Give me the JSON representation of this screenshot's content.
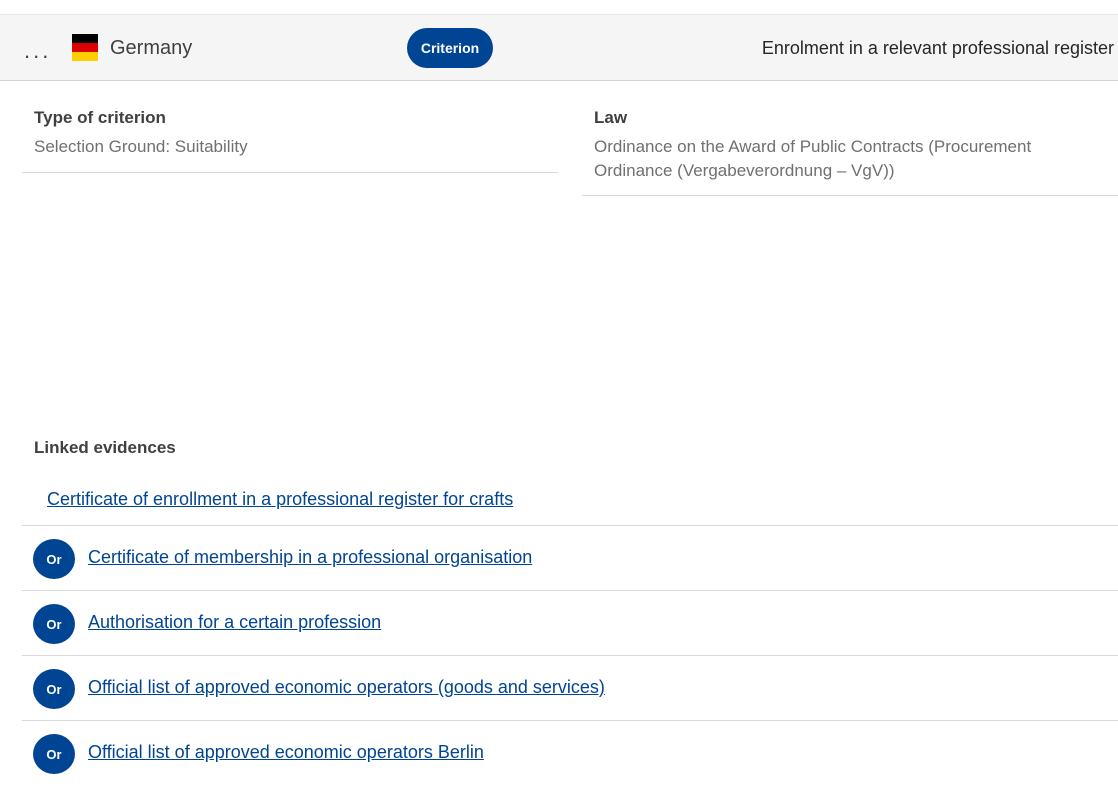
{
  "header": {
    "more_label": "...",
    "country": "Germany",
    "flag_icon": "germany-flag-icon",
    "flag_colors": [
      "#000000",
      "#dd0000",
      "#ffce00"
    ],
    "badge": "Criterion",
    "title": "Enrolment in a relevant professional register"
  },
  "fields": {
    "type_label": "Type of criterion",
    "type_value": "Selection Ground: Suitability",
    "law_label": "Law",
    "law_value": "Ordinance on the Award of Public Contracts (Procurement Ordinance (Vergabeverordnung – VgV))"
  },
  "linked": {
    "heading": "Linked evidences",
    "first": "Certificate of enrollment in a professional register for crafts",
    "items": [
      {
        "prefix": "Or",
        "label": "Certificate of membership in a professional organisation"
      },
      {
        "prefix": "Or",
        "label": "Authorisation for a certain profession"
      },
      {
        "prefix": "Or",
        "label": "Official list of approved economic operators (goods and services)"
      },
      {
        "prefix": "Or",
        "label": "Official list of approved economic operators Berlin"
      }
    ]
  },
  "colors": {
    "accent": "#004494",
    "link": "#004494"
  }
}
